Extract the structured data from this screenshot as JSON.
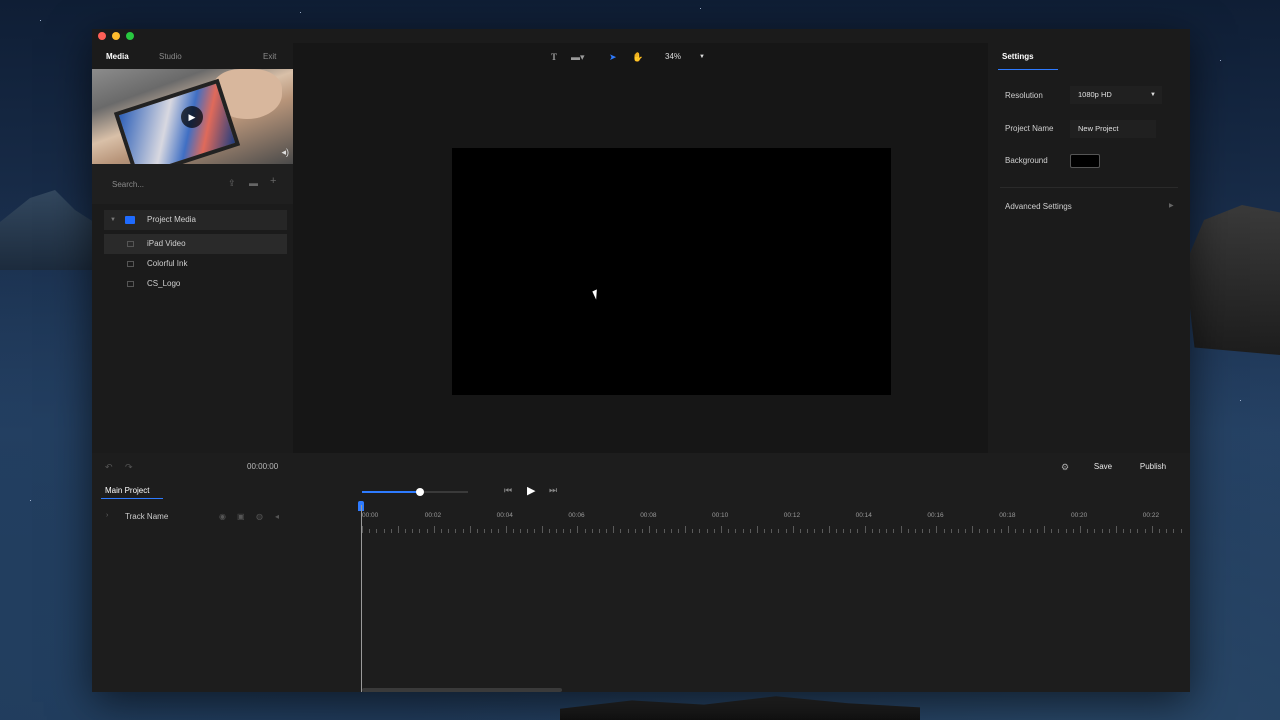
{
  "window": {
    "traffic_colors": [
      "#ff5f57",
      "#febc2e",
      "#28c840"
    ]
  },
  "left_panel": {
    "tabs": [
      "Media",
      "Studio",
      "Exit"
    ],
    "thumbnail_label": "iPad Video",
    "search_placeholder": "Search...",
    "tree": {
      "folder": "Project Media",
      "items": [
        "iPad Video",
        "Colorful Ink",
        "CS_Logo"
      ]
    }
  },
  "toolbar": {
    "tools": [
      "text-tool-icon",
      "shape-tool-icon",
      "select-tool-icon",
      "hand-tool-icon"
    ],
    "zoom": "34%"
  },
  "right_panel": {
    "tab": "Settings",
    "resolution_label": "Resolution",
    "resolution_value": "1080p HD",
    "project_name_label": "Project Name",
    "project_name_value": "New Project",
    "background_label": "Background",
    "background_color": "#000000",
    "advanced_label": "Advanced Settings"
  },
  "control_bar": {
    "time": "00:00:00",
    "save_label": "Save",
    "publish_label": "Publish"
  },
  "timeline": {
    "tab": "Main Project",
    "track_name": "Track Name",
    "ruler_labels": [
      "00:00",
      "00:02",
      "00:04",
      "00:06",
      "00:08",
      "00:10",
      "00:12",
      "00:14",
      "00:16",
      "00:18",
      "00:20",
      "00:22"
    ],
    "volume_fraction": 0.55
  },
  "colors": {
    "accent": "#2e7bff"
  }
}
